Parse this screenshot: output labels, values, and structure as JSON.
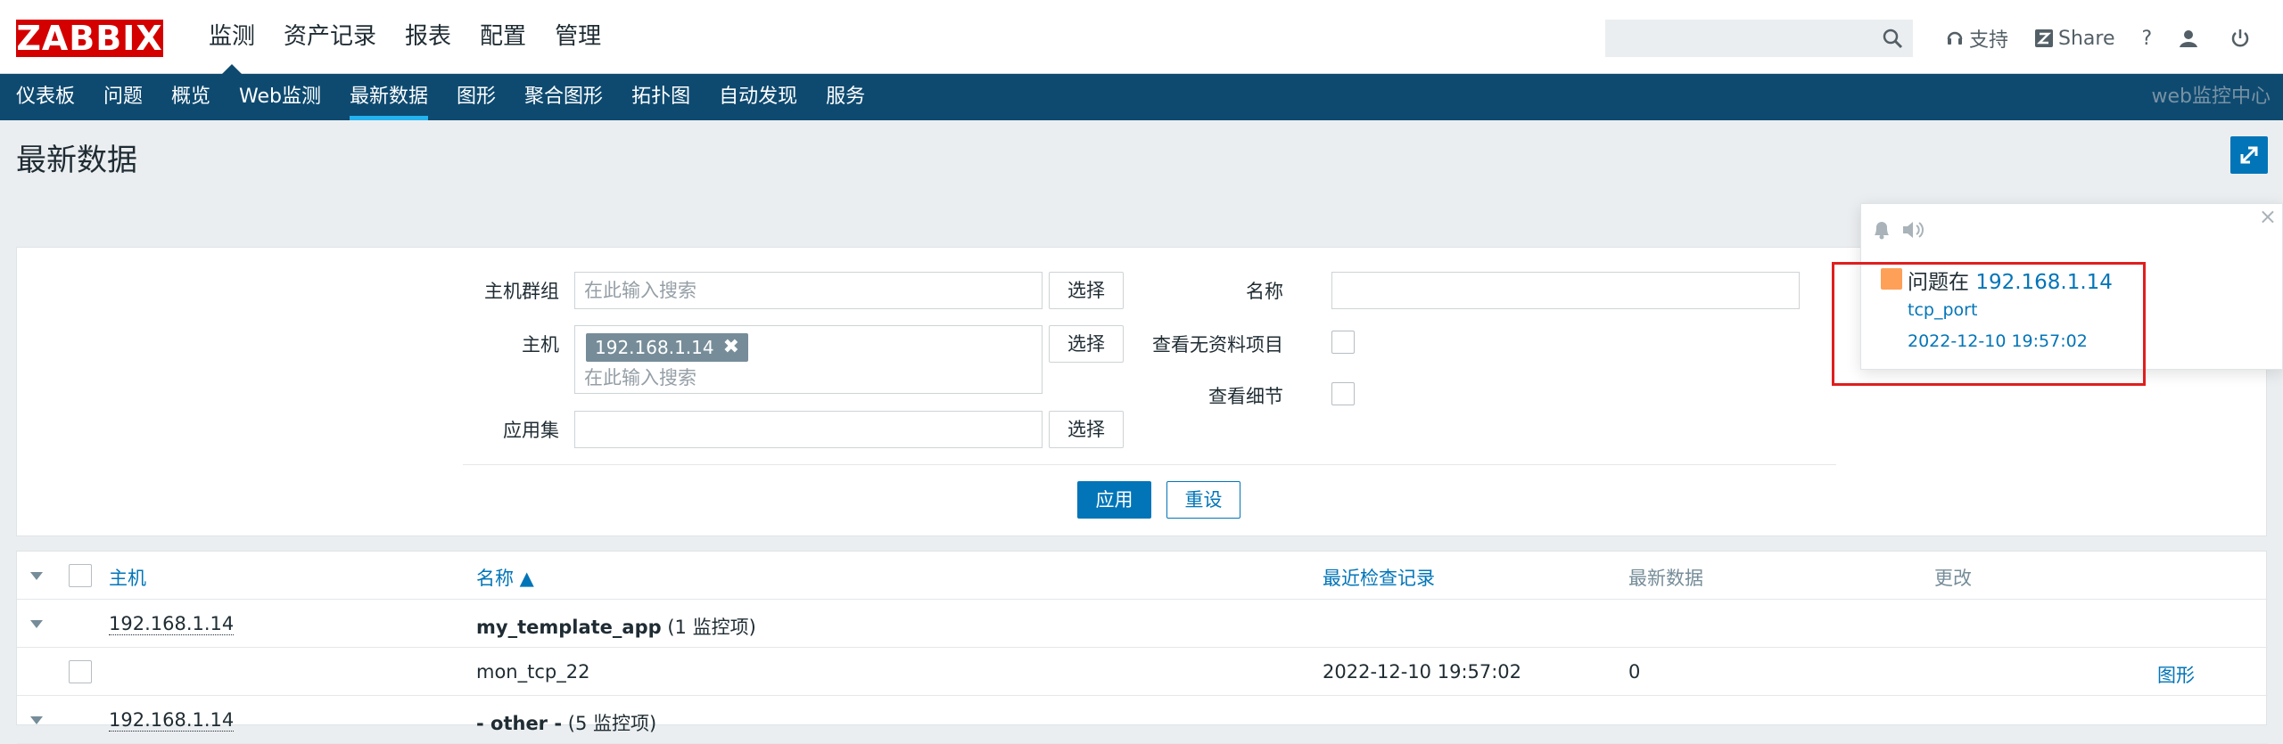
{
  "brand": {
    "logo_text": "ZABBIX",
    "logo_color": "#d40000"
  },
  "top_menu": [
    {
      "label": "监测",
      "active": true
    },
    {
      "label": "资产记录"
    },
    {
      "label": "报表"
    },
    {
      "label": "配置"
    },
    {
      "label": "管理"
    }
  ],
  "top_right": {
    "support": "支持",
    "share": "Share",
    "help": "?"
  },
  "sub_menu": [
    {
      "label": "仪表板"
    },
    {
      "label": "问题"
    },
    {
      "label": "概览"
    },
    {
      "label": "Web监测"
    },
    {
      "label": "最新数据",
      "active": true
    },
    {
      "label": "图形"
    },
    {
      "label": "聚合图形"
    },
    {
      "label": "拓扑图"
    },
    {
      "label": "自动发现"
    },
    {
      "label": "服务"
    }
  ],
  "sub_right": "web监控中心",
  "page_title": "最新数据",
  "filter": {
    "host_group_label": "主机群组",
    "host_group_placeholder": "在此输入搜索",
    "host_label": "主机",
    "host_tag": "192.168.1.14",
    "host_placeholder": "在此输入搜索",
    "app_label": "应用集",
    "select_label": "选择",
    "name_label": "名称",
    "show_no_data_label": "查看无资料项目",
    "show_details_label": "查看细节",
    "apply_label": "应用",
    "reset_label": "重设"
  },
  "table": {
    "headers": {
      "host": "主机",
      "name": "名称 ▲",
      "last_check": "最近检查记录",
      "last_value": "最新数据",
      "change": "更改"
    },
    "groups": [
      {
        "host": "192.168.1.14",
        "app": "my_template_app",
        "count": "(1 监控项)"
      },
      {
        "host": "192.168.1.14",
        "app": "- other -",
        "count": "(5 监控项)"
      }
    ],
    "items": [
      {
        "name": "mon_tcp_22",
        "last_check": "2022-12-10 19:57:02",
        "last_value": "0",
        "action": "图形"
      }
    ]
  },
  "notification": {
    "title_prefix": "问题在",
    "host": "192.168.1.14",
    "item": "tcp_port",
    "time": "2022-12-10 19:57:02",
    "severity_color": "#ffa059"
  }
}
